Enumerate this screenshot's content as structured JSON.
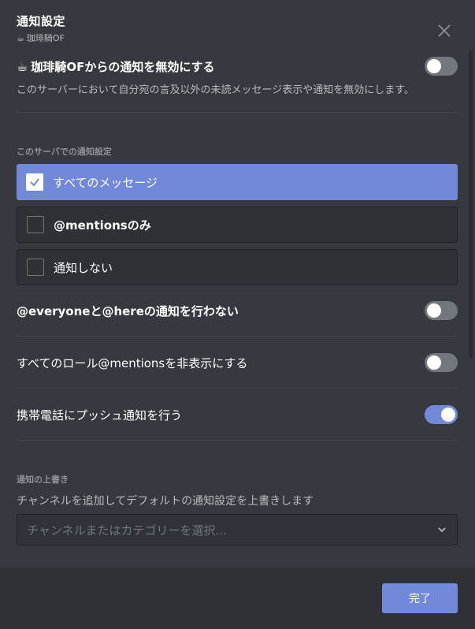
{
  "dialog": {
    "title": "通知設定",
    "server_icon": "☕",
    "server_name": "珈琲騎OF"
  },
  "mute": {
    "icon": "☕",
    "label": "珈琲騎OFからの通知を無効にする",
    "description": "このサーバーにおいて自分宛の言及以外の未読メッセージ表示や通知を無効にします。",
    "enabled": false
  },
  "notification_settings": {
    "section_title": "このサーバでの通知設定",
    "options": [
      {
        "label": "すべてのメッセージ",
        "selected": true
      },
      {
        "label": "@mentionsのみ",
        "selected": false
      },
      {
        "label": "通知しない",
        "selected": false
      }
    ]
  },
  "toggles": [
    {
      "label": "@everyoneと@hereの通知を行わない",
      "enabled": false
    },
    {
      "label": "すべてのロール@mentionsを非表示にする",
      "enabled": false
    },
    {
      "label": "携帯電話にプッシュ通知を行う",
      "enabled": true
    }
  ],
  "overrides": {
    "section_title": "通知の上書き",
    "description": "チャンネルを追加してデフォルトの通知設定を上書きします",
    "placeholder": "チャンネルまたはカテゴリーを選択..."
  },
  "footer": {
    "done_label": "完了"
  },
  "colors": {
    "accent": "#7289da",
    "background": "#36393f",
    "footer": "#2f3136"
  }
}
